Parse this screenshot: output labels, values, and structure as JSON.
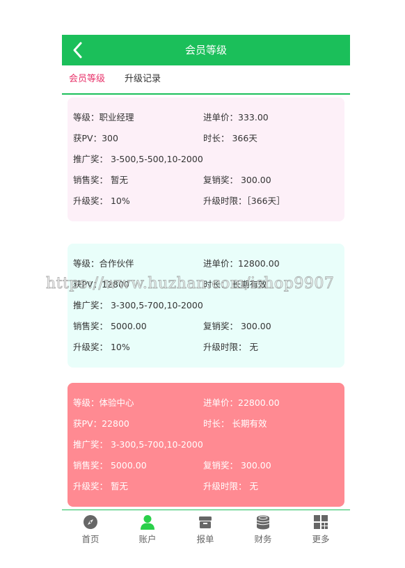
{
  "header": {
    "title": "会员等级"
  },
  "tabs": [
    {
      "label": "会员等级",
      "active": true
    },
    {
      "label": "升级记录",
      "active": false
    }
  ],
  "cards": [
    {
      "level": "等级：职业经理",
      "price": "进单价：333.00",
      "pv": "获PV：300",
      "duration": "时长： 366天",
      "promo": "推广奖： 3-500,5-500,10-2000",
      "sales": "销售奖： 暂无",
      "resale": "复销奖： 300.00",
      "upgrade": "升级奖： 10%",
      "limit": "升级时限：［366天］"
    },
    {
      "level": "等级：合作伙伴",
      "price": "进单价：12800.00",
      "pv": "获PV：12800",
      "duration": "时长： 长期有效",
      "promo": "推广奖： 3-300,5-700,10-2000",
      "sales": "销售奖： 5000.00",
      "resale": "复销奖： 300.00",
      "upgrade": "升级奖： 10%",
      "limit": "升级时限： 无"
    },
    {
      "level": "等级：体验中心",
      "price": "进单价：22800.00",
      "pv": "获PV：22800",
      "duration": "时长： 长期有效",
      "promo": "推广奖： 3-300,5-700,10-2000",
      "sales": "销售奖： 5000.00",
      "resale": "复销奖： 300.00",
      "upgrade": "升级奖： 暂无",
      "limit": "升级时限： 无"
    }
  ],
  "nav": [
    {
      "label": "首页",
      "icon": "compass-icon"
    },
    {
      "label": "账户",
      "icon": "user-icon",
      "active": true
    },
    {
      "label": "报单",
      "icon": "box-icon"
    },
    {
      "label": "财务",
      "icon": "coins-icon"
    },
    {
      "label": "更多",
      "icon": "grid-icon"
    }
  ],
  "watermark": "https://www.huzhan.com/ishop9907",
  "colors": {
    "header": "#1bbf5a",
    "active_tab": "#e8336a",
    "card1_bg": "#fdf0f8",
    "card2_bg": "#e9fefa",
    "card3_bg": "#ff8a92",
    "nav_active": "#2ad04a"
  }
}
